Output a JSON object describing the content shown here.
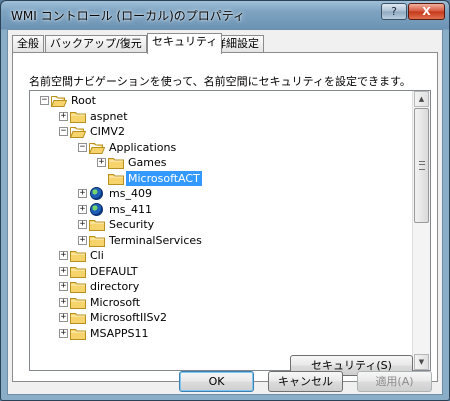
{
  "window": {
    "title": "WMI コントロール (ローカル)のプロパティ",
    "help_glyph": "?",
    "close_glyph": "X"
  },
  "tabs": [
    "全般",
    "バックアップ/復元",
    "セキュリティ",
    "詳細設定"
  ],
  "description": "名前空間ナビゲーションを使って、名前空間にセキュリティを設定できます。",
  "tree": {
    "nodes": [
      {
        "label": "Root",
        "depth": 0,
        "expander": "−",
        "icon": "folder-open",
        "selected": false
      },
      {
        "label": "aspnet",
        "depth": 1,
        "expander": "+",
        "icon": "folder",
        "selected": false
      },
      {
        "label": "CIMV2",
        "depth": 1,
        "expander": "−",
        "icon": "folder-open",
        "selected": false
      },
      {
        "label": "Applications",
        "depth": 2,
        "expander": "−",
        "icon": "folder-open",
        "selected": false
      },
      {
        "label": "Games",
        "depth": 3,
        "expander": "+",
        "icon": "folder",
        "selected": false
      },
      {
        "label": "MicrosoftACT",
        "depth": 3,
        "expander": "",
        "icon": "folder",
        "selected": true
      },
      {
        "label": "ms_409",
        "depth": 2,
        "expander": "+",
        "icon": "globe",
        "selected": false
      },
      {
        "label": "ms_411",
        "depth": 2,
        "expander": "+",
        "icon": "globe",
        "selected": false
      },
      {
        "label": "Security",
        "depth": 2,
        "expander": "+",
        "icon": "folder",
        "selected": false
      },
      {
        "label": "TerminalServices",
        "depth": 2,
        "expander": "+",
        "icon": "folder",
        "selected": false
      },
      {
        "label": "Cli",
        "depth": 1,
        "expander": "+",
        "icon": "folder",
        "selected": false
      },
      {
        "label": "DEFAULT",
        "depth": 1,
        "expander": "+",
        "icon": "folder",
        "selected": false
      },
      {
        "label": "directory",
        "depth": 1,
        "expander": "+",
        "icon": "folder",
        "selected": false
      },
      {
        "label": "Microsoft",
        "depth": 1,
        "expander": "+",
        "icon": "folder",
        "selected": false
      },
      {
        "label": "MicrosoftIISv2",
        "depth": 1,
        "expander": "+",
        "icon": "folder",
        "selected": false
      },
      {
        "label": "MSAPPS11",
        "depth": 1,
        "expander": "+",
        "icon": "folder",
        "selected": false
      }
    ],
    "scroll_up_glyph": "▲",
    "scroll_down_glyph": "▼"
  },
  "buttons": {
    "security": "セキュリティ(S)",
    "ok": "OK",
    "cancel": "キャンセル",
    "apply": "適用(A)"
  },
  "colors": {
    "selection": "#3399ff",
    "folder": "#f6d36b",
    "folder_edge": "#b8901f"
  }
}
